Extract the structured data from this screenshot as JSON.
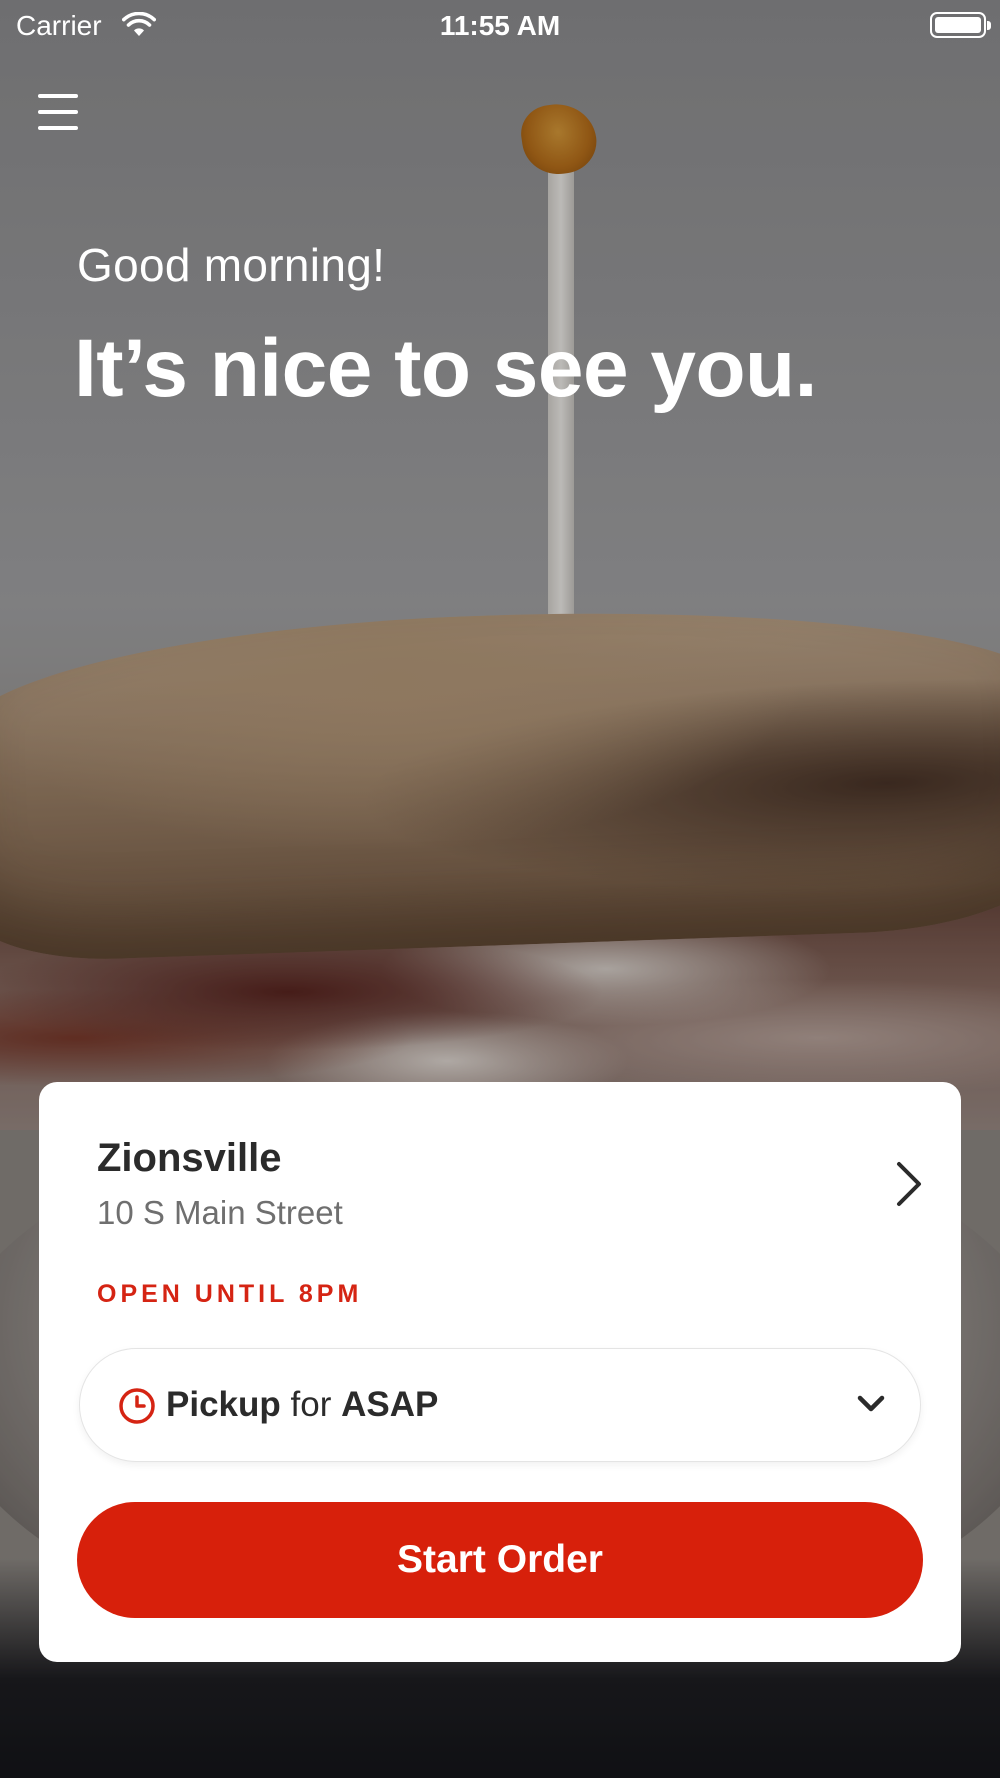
{
  "status_bar": {
    "carrier": "Carrier",
    "time": "11:55 AM",
    "icons": [
      "wifi-icon",
      "battery-icon"
    ]
  },
  "header": {
    "menu_icon": "hamburger-menu-icon"
  },
  "hero": {
    "greeting": "Good morning!",
    "headline": "It’s nice to see you."
  },
  "location_card": {
    "name": "Zionsville",
    "address": "10 S Main Street",
    "hours": "OPEN UNTIL 8PM",
    "chevron_icon": "chevron-right-icon"
  },
  "order_mode": {
    "icon": "clock-icon",
    "mode": "Pickup",
    "connector": "for",
    "time": "ASAP",
    "dropdown_icon": "chevron-down-icon"
  },
  "actions": {
    "start_order_label": "Start Order"
  },
  "colors": {
    "accent": "#d7200b",
    "hours_text": "#d52413",
    "card_background": "#ffffff",
    "primary_text": "#2b2b2b",
    "secondary_text": "#6f6f6f"
  }
}
